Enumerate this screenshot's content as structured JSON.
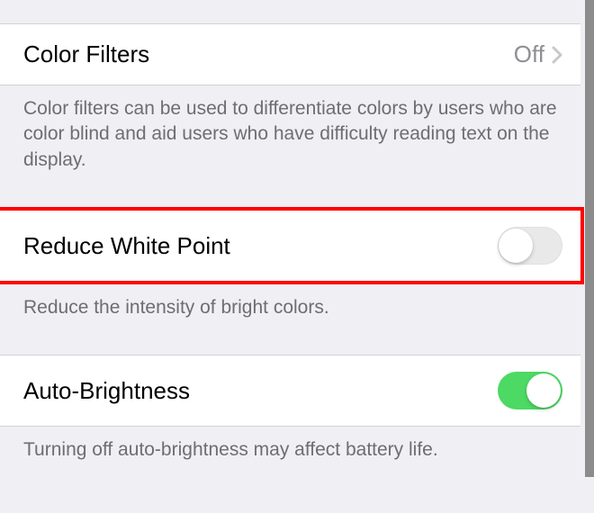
{
  "colorFilters": {
    "label": "Color Filters",
    "value": "Off",
    "description": "Color filters can be used to differentiate colors by users who are color blind and aid users who have difficulty reading text on the display."
  },
  "reduceWhitePoint": {
    "label": "Reduce White Point",
    "enabled": false,
    "description": "Reduce the intensity of bright colors."
  },
  "autoBrightness": {
    "label": "Auto-Brightness",
    "enabled": true,
    "description": "Turning off auto-brightness may affect battery life."
  }
}
